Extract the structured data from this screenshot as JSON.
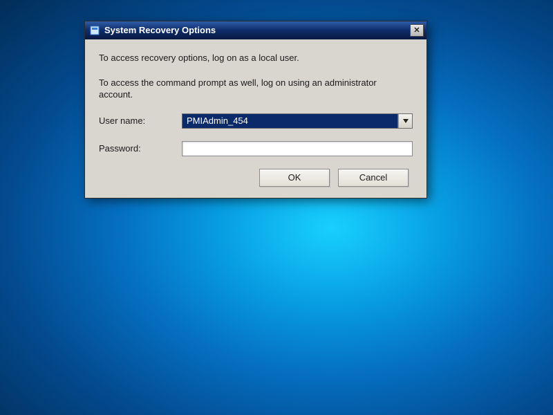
{
  "window": {
    "title": "System Recovery Options",
    "close_symbol": "✕"
  },
  "body": {
    "instruction1": "To access recovery options, log on as a local user.",
    "instruction2": "To access the command prompt as well, log on using an administrator account.",
    "username_label": "User name:",
    "password_label": "Password:",
    "username_value": "PMIAdmin_454",
    "password_value": ""
  },
  "buttons": {
    "ok": "OK",
    "cancel": "Cancel"
  }
}
